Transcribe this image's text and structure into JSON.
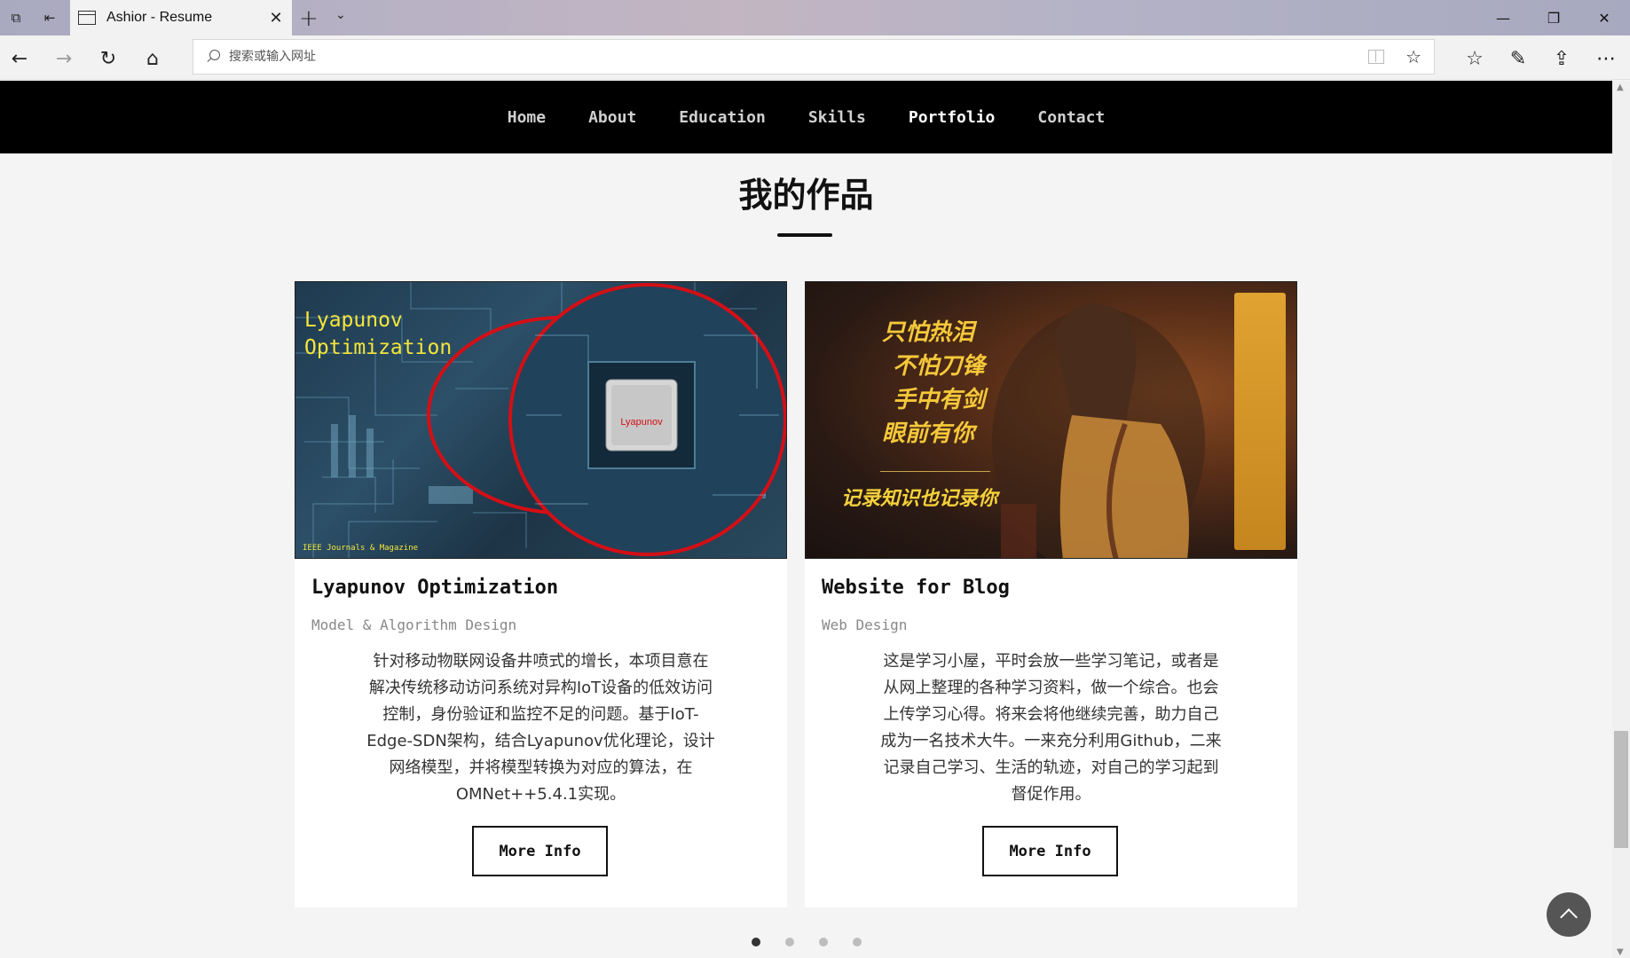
{
  "browser": {
    "tab_title": "Ashior - Resume",
    "address_placeholder": "搜索或输入网址"
  },
  "site_nav": {
    "items": [
      "Home",
      "About",
      "Education",
      "Skills",
      "Portfolio",
      "Contact"
    ],
    "active": "Portfolio"
  },
  "section": {
    "title": "我的作品"
  },
  "cards": [
    {
      "thumb_title_line1": "Lyapunov",
      "thumb_title_line2": "Optimization",
      "thumb_chip": "Lyapunov",
      "thumb_footer": "IEEE Journals & Magazine",
      "title": "Lyapunov Optimization",
      "category": "Model & Algorithm Design",
      "description": "针对移动物联网设备井喷式的增长，本项目意在解决传统移动访问系统对异构IoT设备的低效访问控制，身份验证和监控不足的问题。基于IoT-Edge-SDN架构，结合Lyapunov优化理论，设计网络模型，并将模型转换为对应的算法，在OMNet++5.4.1实现。",
      "button": "More Info"
    },
    {
      "thumb_poem": [
        "只怕热泪",
        "不怕刀锋",
        "手中有剑",
        "眼前有你"
      ],
      "thumb_tagline": "记录知识也记录你",
      "title": "Website for Blog",
      "category": "Web Design",
      "description": "这是学习小屋，平时会放一些学习笔记，或者是从网上整理的各种学习资料，做一个综合。也会上传学习心得。将来会将他继续完善，助力自己成为一名技术大牛。一来充分利用Github，二来记录自己学习、生活的轨迹，对自己的学习起到督促作用。",
      "button": "More Info"
    }
  ],
  "pagination": {
    "total": 4,
    "active": 1
  },
  "colors": {
    "nav_bg": "#000000",
    "accent_yellow": "#f5e63a",
    "ring_red": "#d40f16"
  }
}
